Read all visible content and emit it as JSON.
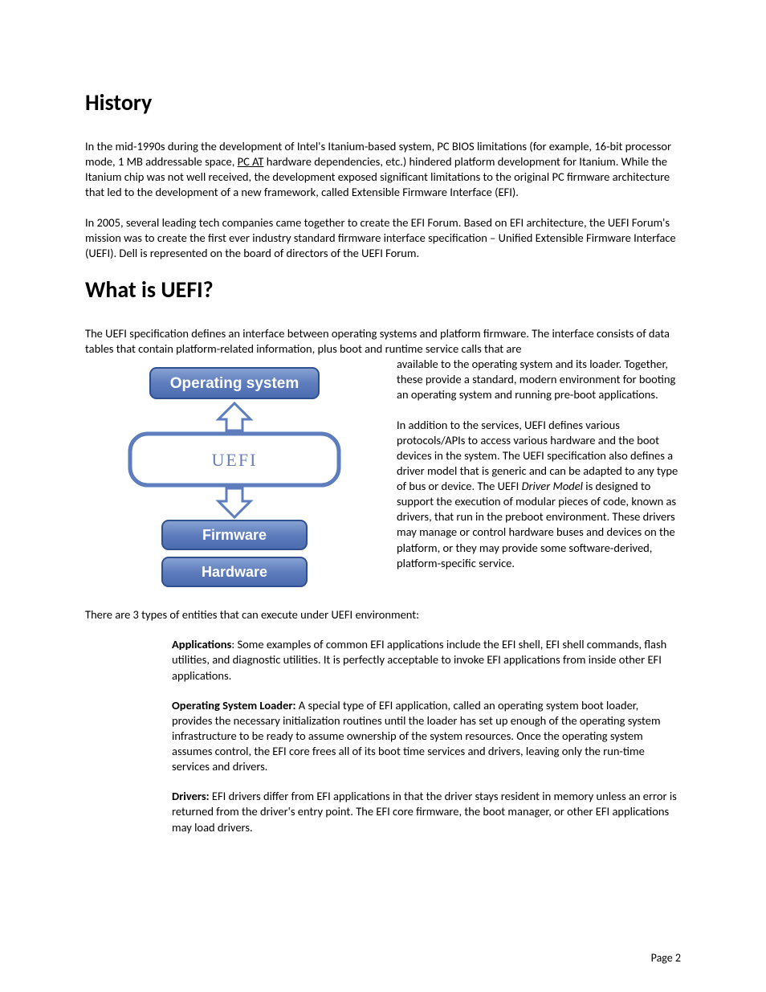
{
  "headings": {
    "history": "History",
    "whatis": "What is UEFI?"
  },
  "paragraphs": {
    "p1a": "In the mid-1990s during the development of Intel's Itanium-based system, PC BIOS limitations (for example, 16-bit processor mode, 1 MB addressable space, ",
    "p1_link": "PC AT",
    "p1b": " hardware dependencies, etc.) hindered platform development for Itanium.  While the Itanium chip was not well received, the development exposed significant limitations to the original PC firmware architecture that led to the development of a new framework, called Extensible Firmware Interface (EFI).",
    "p2": "In 2005, several leading tech companies came together to create the EFI Forum. Based on EFI architecture, the UEFI Forum's mission was to create the first ever industry standard firmware interface specification – Unified Extensible Firmware Interface (UEFI).  Dell is represented on the board of directors of the UEFI Forum.",
    "p3a": "The UEFI specification defines an interface between operating systems and platform firmware. The interface consists of data tables that contain platform-related information, plus boot and runtime service calls that are ",
    "p3b": "available to the operating system and its loader. Together, these provide a standard, modern environment for booting an operating system and running pre-boot applications.",
    "p4a": "In addition to the services, UEFI defines various protocols/APIs to access various hardware and the boot devices in the system. The UEFI specification also defines a driver model that is generic and can be adapted to any type of bus or device.  The UEFI ",
    "p4_italic": "Driver Model",
    "p4b": " is designed to support the execution of modular pieces of code, known as drivers, that run in the preboot environment. These drivers may manage or control hardware buses and devices on the platform, or they may provide some software-derived, platform-specific service.",
    "p5": "There are 3 types of entities that can execute under UEFI environment:",
    "apps_label": "Applications",
    "apps_text": ": Some examples of common EFI applications include the EFI shell, EFI shell commands, flash utilities, and diagnostic utilities. It is perfectly acceptable to invoke EFI applications from inside other EFI applications.",
    "osl_label": "Operating System Loader:",
    "osl_text": " A special type of EFI application, called an operating system boot loader, provides the necessary initialization routines until the loader has set up enough of the operating system infrastructure to be ready to assume ownership of the system resources. Once the operating system assumes control, the EFI core frees all of its boot time services and drivers, leaving only the run-time services and drivers.",
    "drv_label": "Drivers:",
    "drv_text": " EFI drivers differ from EFI applications in that the driver stays resident in memory unless an error is returned from the driver's entry point. The EFI core firmware, the boot manager, or other EFI applications may load drivers."
  },
  "diagram": {
    "os": "Operating system",
    "uefi": "UEFI",
    "firmware": "Firmware",
    "hardware": "Hardware"
  },
  "page_number": "Page 2"
}
